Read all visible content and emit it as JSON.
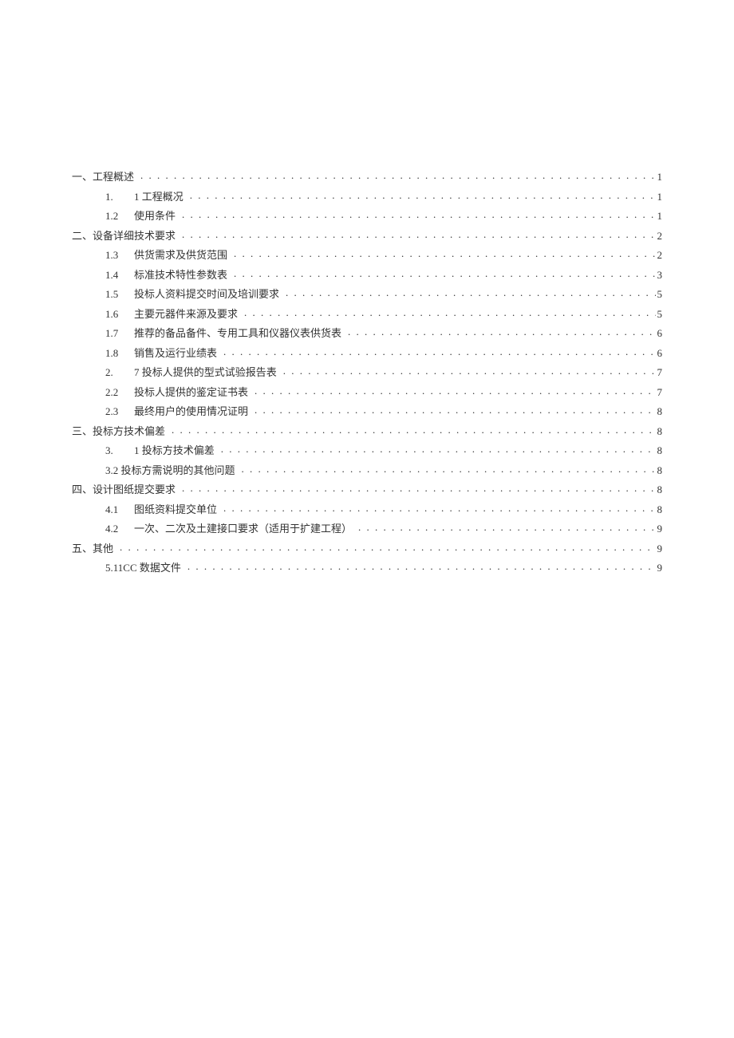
{
  "toc": [
    {
      "level": 1,
      "num": "一、",
      "title": "工程概述",
      "page": "1"
    },
    {
      "level": 2,
      "num": "1.",
      "title": "1 工程概况",
      "page": "1"
    },
    {
      "level": 2,
      "num": "1.2",
      "title": "使用条件",
      "page": "1"
    },
    {
      "level": 1,
      "num": "二、",
      "title": "设备详细技术要求",
      "page": "2"
    },
    {
      "level": 2,
      "num": "1.3",
      "title": "供货需求及供货范围",
      "page": "2"
    },
    {
      "level": 2,
      "num": "1.4",
      "title": "标准技术特性参数表",
      "page": "3"
    },
    {
      "level": 2,
      "num": "1.5",
      "title": "投标人资料提交时间及培训要求",
      "page": "5"
    },
    {
      "level": 2,
      "num": "1.6",
      "title": "主要元器件来源及要求",
      "page": "5"
    },
    {
      "level": 2,
      "num": "1.7",
      "title": "推荐的备品备件、专用工具和仪器仪表供货表",
      "page": "6"
    },
    {
      "level": 2,
      "num": "1.8",
      "title": "销售及运行业绩表",
      "page": "6"
    },
    {
      "level": 2,
      "num": "2.",
      "title": "7 投标人提供的型式试验报告表",
      "page": "7"
    },
    {
      "level": 2,
      "num": "2.2",
      "title": "投标人提供的鉴定证书表",
      "page": "7"
    },
    {
      "level": 2,
      "num": "2.3",
      "title": "最终用户的使用情况证明",
      "page": "8"
    },
    {
      "level": 1,
      "num": "三、",
      "title": "投标方技术偏差",
      "page": "8"
    },
    {
      "level": 2,
      "num": "3.",
      "title": "1 投标方技术偏差",
      "page": "8"
    },
    {
      "level": 2,
      "num": "",
      "title": "3.2 投标方需说明的其他问题",
      "page": "8",
      "nonum": true
    },
    {
      "level": 1,
      "num": "四、",
      "title": "设计图纸提交要求",
      "page": "8"
    },
    {
      "level": 2,
      "num": "4.1",
      "title": "图纸资料提交单位",
      "page": "8"
    },
    {
      "level": 2,
      "num": "4.2",
      "title": " 一次、二次及土建接口要求（适用于扩建工程）",
      "page": "9"
    },
    {
      "level": 1,
      "num": "五、",
      "title": "其他",
      "page": "9"
    },
    {
      "level": 2,
      "num": "",
      "title": "5.11CC 数据文件",
      "page": "9",
      "nonum": true
    }
  ]
}
